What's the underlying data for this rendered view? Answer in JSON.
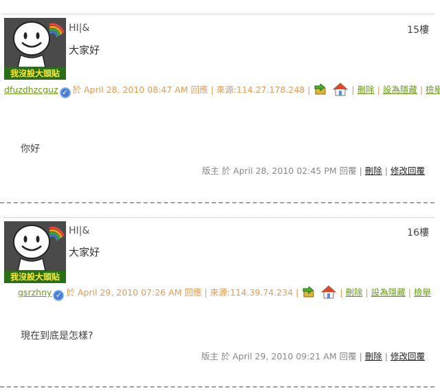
{
  "posts": [
    {
      "avatar_caption": "我沒設大頭貼",
      "title": "HI|&",
      "floor": "15樓",
      "content": "大家好",
      "author": "dfuzdhzcguz",
      "meta_text": "於 April 28, 2010 08:47 AM 回應 | 來源:114.27.178.248 |",
      "delete_label": "刪除",
      "hide_label": "設為隱藏",
      "report_label": "檢舉",
      "reply": {
        "content": "你好",
        "meta_text": "版主 於 April 28, 2010 02:45 PM 回覆 |",
        "delete_label": "刪除",
        "edit_label": "修改回覆"
      }
    },
    {
      "avatar_caption": "我沒設大頭貼",
      "title": "HI|&",
      "floor": "16樓",
      "content": "大家好",
      "author": "gsrzhny",
      "meta_text": "於 April 29, 2010 07:26 AM 回應 | 來源:114.39.74.234 |",
      "delete_label": "刪除",
      "hide_label": "設為隱藏",
      "report_label": "檢舉",
      "reply": {
        "content": "現在到底是怎樣?",
        "meta_text": "版主 於 April 29, 2010 09:21 AM 回覆 |",
        "delete_label": "刪除",
        "edit_label": "修改回覆"
      }
    }
  ],
  "icons": {
    "verified": "verified-check-icon",
    "ip_lookup": "ip-lookup-icon",
    "homepage": "home-icon"
  },
  "colors": {
    "meta_orange": "#e59a52",
    "link_green": "#6a9a1a",
    "avatar_caption_bg": "#2a6f17",
    "avatar_caption_text": "#ffe92c"
  }
}
